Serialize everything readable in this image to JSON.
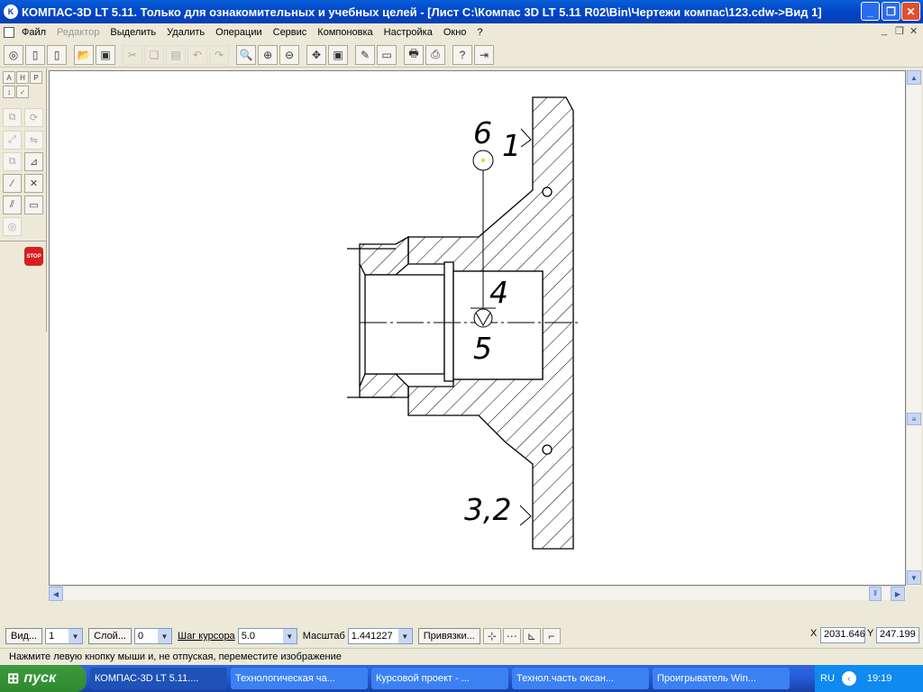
{
  "window": {
    "title": "КОМПАС-3D LT 5.11. Только для ознакомительных и учебных целей - [Лист С:\\Компас 3D LT 5.11 R02\\Bin\\Чертежи компас\\123.cdw->Вид 1]"
  },
  "menu": {
    "items": [
      "Файл",
      "Редактор",
      "Выделить",
      "Удалить",
      "Операции",
      "Сервис",
      "Компоновка",
      "Настройка",
      "Окно",
      "?"
    ]
  },
  "drawing": {
    "labels": {
      "six": "6",
      "one": "1",
      "four": "4",
      "five": "5",
      "three_two": "3,2"
    }
  },
  "props": {
    "view_label": "Вид...",
    "view_value": "1",
    "layer_label": "Слой...",
    "layer_value": "0",
    "step_label": "Шаг курсора",
    "step_value": "5.0",
    "scale_label": "Масштаб",
    "scale_value": "1.441227",
    "snap_label": "Привязки...",
    "x_label": "X",
    "x_value": "2031.646",
    "y_label": "Y",
    "y_value": "247.199"
  },
  "status": {
    "text": "Нажмите левую кнопку мыши и, не отпуская, переместите изображение"
  },
  "taskbar": {
    "start": "пуск",
    "tasks": [
      "КОМПАС-3D LT 5.11....",
      "Технологическая ча...",
      "Курсовой проект - ...",
      "Технол.часть оксан...",
      "Проигрыватель Win..."
    ],
    "lang": "RU",
    "time": "19:19"
  }
}
